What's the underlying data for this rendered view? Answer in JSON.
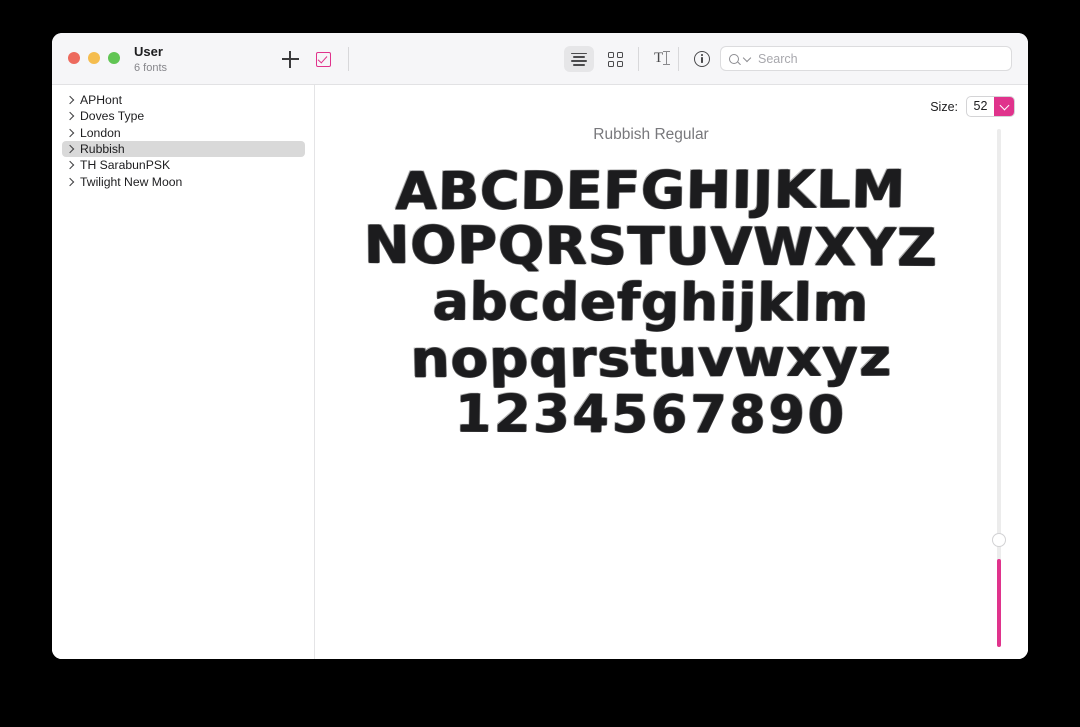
{
  "window": {
    "traffic_lights": [
      {
        "name": "close",
        "color": "#ed6a5e"
      },
      {
        "name": "minimize",
        "color": "#f5bd4f"
      },
      {
        "name": "zoom",
        "color": "#61c554"
      }
    ],
    "title": "User",
    "subtitle": "6 fonts"
  },
  "toolbar": {
    "add_label": "+",
    "validate_label": "Validate",
    "view_buttons": [
      {
        "name": "samples",
        "label": "Samples",
        "active": true
      },
      {
        "name": "repertoire",
        "label": "Repertoire",
        "active": false
      },
      {
        "name": "custom",
        "label": "Custom",
        "active": false
      },
      {
        "name": "info",
        "label": "Info",
        "active": false
      }
    ]
  },
  "search": {
    "placeholder": "Search",
    "value": ""
  },
  "sidebar": {
    "items": [
      {
        "label": "APHont",
        "selected": false
      },
      {
        "label": "Doves Type",
        "selected": false
      },
      {
        "label": "London",
        "selected": false
      },
      {
        "label": "Rubbish",
        "selected": true
      },
      {
        "label": "TH SarabunPSK",
        "selected": false
      },
      {
        "label": "Twilight New Moon",
        "selected": false
      }
    ]
  },
  "detail": {
    "size_label": "Size:",
    "size_value": "52",
    "font_title": "Rubbish Regular",
    "specimen_lines": [
      "ABCDEFGHIJKLM",
      "NOPQRSTUVWXYZ",
      "abcdefghijklm",
      "nopqrstuvwxyz",
      "1234567890"
    ]
  },
  "colors": {
    "accent": "#e0338c",
    "selection": "#d9d9d9",
    "toolbar_bg": "#f6f6f8",
    "text": "#1d1d1f",
    "muted_text": "#78787c"
  }
}
